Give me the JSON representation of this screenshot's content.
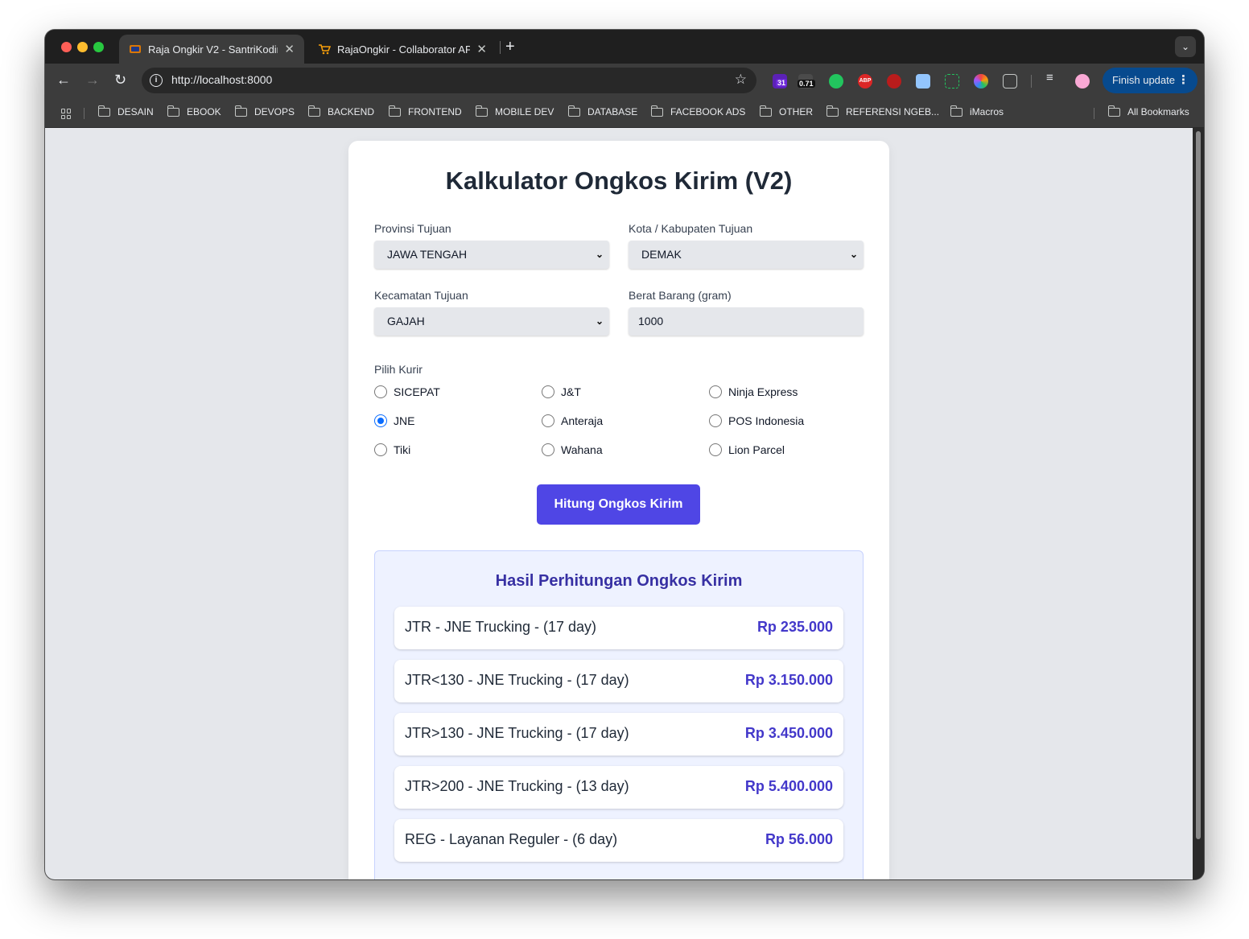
{
  "browser": {
    "tabs": [
      {
        "title": "Raja Ongkir V2 - SantriKoding",
        "active": true
      },
      {
        "title": "RajaOngkir - Collaborator API",
        "active": false
      }
    ],
    "url": "http://localhost:8000",
    "extensions": {
      "badge_31": "31",
      "badge_071": "0.71",
      "abp": "ABP"
    },
    "finish_update_label": "Finish update",
    "bookmarks": [
      "DESAIN",
      "EBOOK",
      "DEVOPS",
      "BACKEND",
      "FRONTEND",
      "MOBILE DEV",
      "DATABASE",
      "FACEBOOK ADS",
      "OTHER",
      "REFERENSI NGEB...",
      "iMacros"
    ],
    "all_bookmarks": "All Bookmarks"
  },
  "form": {
    "title": "Kalkulator Ongkos Kirim (V2)",
    "province": {
      "label": "Provinsi Tujuan",
      "value": "JAWA TENGAH"
    },
    "city": {
      "label": "Kota / Kabupaten Tujuan",
      "value": "DEMAK"
    },
    "district": {
      "label": "Kecamatan Tujuan",
      "value": "GAJAH"
    },
    "weight": {
      "label": "Berat Barang (gram)",
      "value": "1000"
    },
    "courier_label": "Pilih Kurir",
    "couriers": [
      {
        "label": "SICEPAT",
        "checked": false
      },
      {
        "label": "J&T",
        "checked": false
      },
      {
        "label": "Ninja Express",
        "checked": false
      },
      {
        "label": "JNE",
        "checked": true
      },
      {
        "label": "Anteraja",
        "checked": false
      },
      {
        "label": "POS Indonesia",
        "checked": false
      },
      {
        "label": "Tiki",
        "checked": false
      },
      {
        "label": "Wahana",
        "checked": false
      },
      {
        "label": "Lion Parcel",
        "checked": false
      }
    ],
    "submit_label": "Hitung Ongkos Kirim"
  },
  "results": {
    "title": "Hasil Perhitungan Ongkos Kirim",
    "items": [
      {
        "service": "JTR - JNE Trucking - (17 day)",
        "price": "Rp 235.000"
      },
      {
        "service": "JTR<130 - JNE Trucking - (17 day)",
        "price": "Rp 3.150.000"
      },
      {
        "service": "JTR>130 - JNE Trucking - (17 day)",
        "price": "Rp 3.450.000"
      },
      {
        "service": "JTR>200 - JNE Trucking - (13 day)",
        "price": "Rp 5.400.000"
      },
      {
        "service": "REG - Layanan Reguler - (6 day)",
        "price": "Rp 56.000"
      }
    ]
  },
  "colors": {
    "accent": "#4f46e5",
    "price": "#4338ca",
    "results_bg": "#eef2ff",
    "page_bg": "#e5e7eb"
  }
}
